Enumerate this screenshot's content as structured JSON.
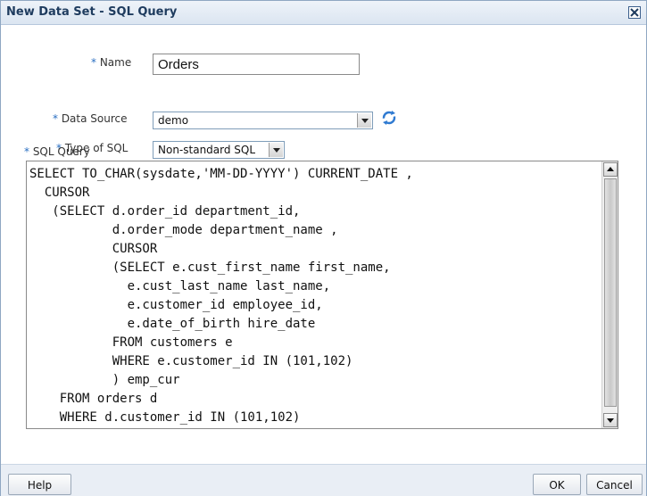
{
  "dialog": {
    "title": "New Data Set - SQL Query",
    "close_icon": "close-icon"
  },
  "form": {
    "name_label": "* Name",
    "name_value": "Orders",
    "data_source_label": "* Data Source",
    "data_source_value": "demo",
    "refresh_icon": "refresh-icon",
    "type_of_sql_label": "* Type of SQL",
    "type_of_sql_value": "Non-standard SQL",
    "sql_query_label": "* SQL Query",
    "sql_query_text": "SELECT TO_CHAR(sysdate,'MM-DD-YYYY') CURRENT_DATE ,\n  CURSOR\n   (SELECT d.order_id department_id,\n           d.order_mode department_name ,\n           CURSOR\n           (SELECT e.cust_first_name first_name,\n             e.cust_last_name last_name,\n             e.customer_id employee_id,\n             e.date_of_birth hire_date\n           FROM customers e\n           WHERE e.customer_id IN (101,102)\n           ) emp_cur\n    FROM orders d\n    WHERE d.customer_id IN (101,102)"
  },
  "footer": {
    "help_label": "Help",
    "ok_label": "OK",
    "cancel_label": "Cancel"
  },
  "colors": {
    "title_text": "#1e3b5e",
    "required_marker": "#2a6fc2",
    "footer_bg": "#e9eef5"
  }
}
